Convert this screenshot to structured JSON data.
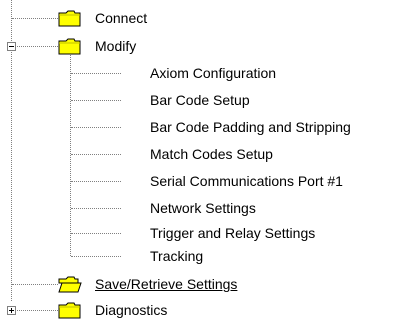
{
  "colors": {
    "folder_fill": "#ffff00",
    "folder_stroke": "#000000",
    "tree_line": "#808080",
    "text": "#000000",
    "background": "#ffffff"
  },
  "tree": {
    "connect": {
      "label": "Connect",
      "icon": "folder-closed-icon"
    },
    "modify": {
      "label": "Modify",
      "icon": "folder-closed-icon",
      "expander": "collapse-minus-icon",
      "children": [
        "Axiom Configuration",
        "Bar Code Setup",
        "Bar Code Padding and Stripping",
        "Match Codes Setup",
        "Serial Communications Port #1",
        "Network Settings",
        "Trigger and Relay Settings",
        "Tracking"
      ]
    },
    "save_retrieve": {
      "label": "Save/Retrieve Settings",
      "icon": "folder-open-icon"
    },
    "diagnostics": {
      "label": "Diagnostics",
      "icon": "folder-closed-icon",
      "expander": "expand-plus-icon"
    }
  }
}
